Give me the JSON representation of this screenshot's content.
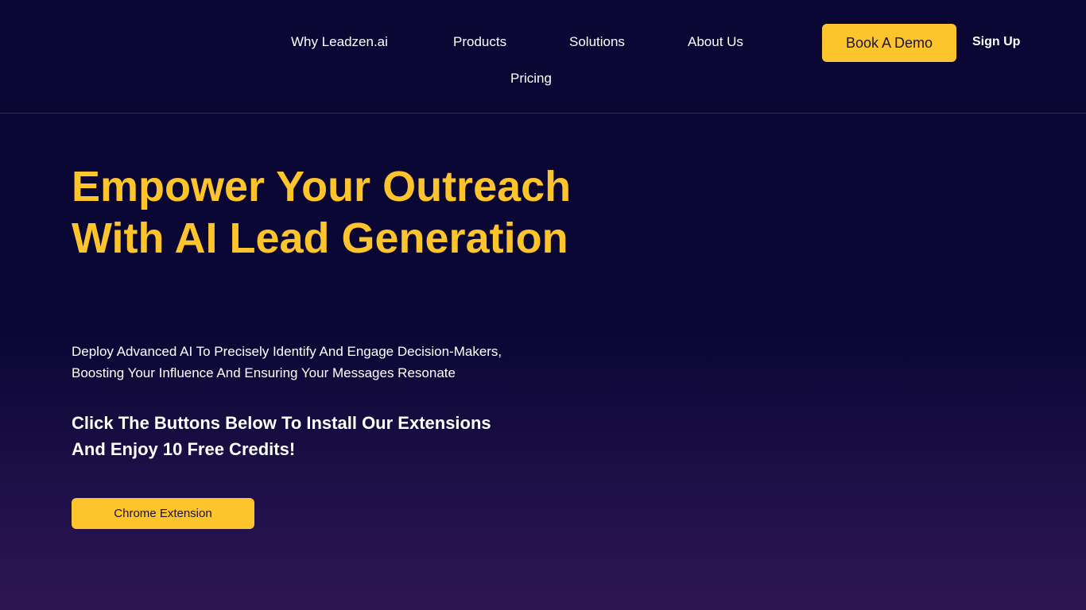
{
  "nav": {
    "items": [
      {
        "label": "Why Leadzen.ai"
      },
      {
        "label": "Products"
      },
      {
        "label": "Solutions"
      },
      {
        "label": "About Us"
      },
      {
        "label": "Pricing"
      }
    ],
    "demo_label": "Book A Demo",
    "signup_label": "Sign Up"
  },
  "hero": {
    "title": "Empower Your Outreach With AI Lead Generation",
    "subtitle": "Deploy Advanced AI To Precisely Identify And Engage Decision-Makers, Boosting Your Influence And Ensuring Your Messages Resonate",
    "cta_text": "Click The Buttons Below To Install Our Extensions And Enjoy 10 Free Credits!",
    "chrome_button_label": "Chrome Extension"
  },
  "colors": {
    "background": "#0b0735",
    "accent": "#fec42c",
    "text": "#ffffff"
  }
}
